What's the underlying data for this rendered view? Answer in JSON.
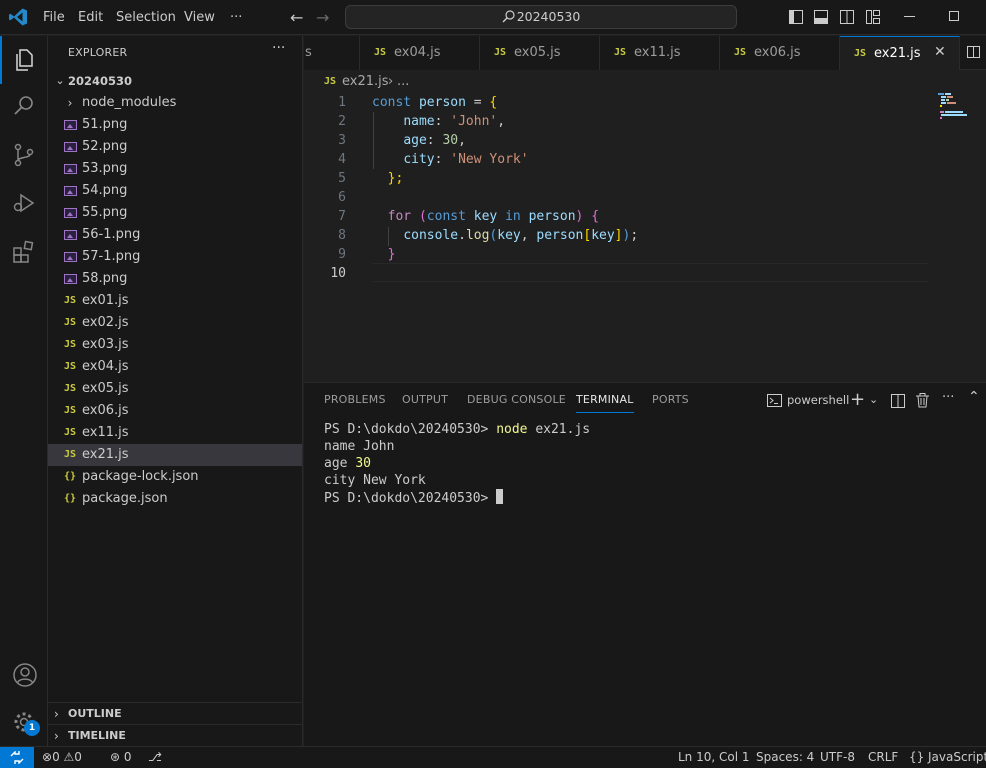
{
  "titlebar": {
    "menus": [
      "File",
      "Edit",
      "Selection",
      "View",
      "···"
    ],
    "search": "20240530"
  },
  "activity": {
    "items": [
      "explorer-icon",
      "search-icon",
      "source-control-icon",
      "run-debug-icon",
      "extensions-icon"
    ],
    "accounts": "account-icon",
    "manage": "gear-icon",
    "manage_badge": "1"
  },
  "explorer": {
    "title": "EXPLORER",
    "more": "···",
    "root": "20240530",
    "items": [
      {
        "label": "node_modules",
        "type": "folder"
      },
      {
        "label": "51.png",
        "type": "png"
      },
      {
        "label": "52.png",
        "type": "png"
      },
      {
        "label": "53.png",
        "type": "png"
      },
      {
        "label": "54.png",
        "type": "png"
      },
      {
        "label": "55.png",
        "type": "png"
      },
      {
        "label": "56-1.png",
        "type": "png"
      },
      {
        "label": "57-1.png",
        "type": "png"
      },
      {
        "label": "58.png",
        "type": "png"
      },
      {
        "label": "ex01.js",
        "type": "js"
      },
      {
        "label": "ex02.js",
        "type": "js"
      },
      {
        "label": "ex03.js",
        "type": "js"
      },
      {
        "label": "ex04.js",
        "type": "js"
      },
      {
        "label": "ex05.js",
        "type": "js"
      },
      {
        "label": "ex06.js",
        "type": "js"
      },
      {
        "label": "ex11.js",
        "type": "js"
      },
      {
        "label": "ex21.js",
        "type": "js",
        "selected": true
      },
      {
        "label": "package-lock.json",
        "type": "json"
      },
      {
        "label": "package.json",
        "type": "json"
      }
    ],
    "outline": "OUTLINE",
    "timeline": "TIMELINE"
  },
  "tabs": {
    "partial": "s",
    "items": [
      "ex04.js",
      "ex05.js",
      "ex11.js",
      "ex06.js",
      "ex21.js"
    ],
    "active": "ex21.js",
    "js_badge": "JS",
    "close": "✕"
  },
  "breadcrumb": {
    "file": "ex21.js",
    "rest": "..."
  },
  "editor": {
    "line_numbers": [
      "1",
      "2",
      "3",
      "4",
      "5",
      "6",
      "7",
      "8",
      "9",
      "10"
    ],
    "current_line": "10",
    "code": {
      "kw_const": "const",
      "var_person": "person",
      "eq": " = ",
      "brace_open": "{",
      "key_name": "name",
      "str_john": "'John'",
      "key_age": "age",
      "num_30": "30",
      "key_city": "city",
      "str_ny": "'New York'",
      "brace_close": "};",
      "kw_for": "for",
      "kw_in": "in",
      "var_key": "key",
      "fn_console": "console",
      "fn_log": "log",
      "close_brace": "}"
    }
  },
  "panel": {
    "tabs": [
      "PROBLEMS",
      "OUTPUT",
      "DEBUG CONSOLE",
      "TERMINAL",
      "PORTS"
    ],
    "active_tab": "TERMINAL",
    "shell": "powershell",
    "terminal": {
      "prompt": "PS D:\\dokdo\\20240530> ",
      "cmd_node": "node",
      "cmd_arg": " ex21.js",
      "out1": "name John",
      "out2_label": "age ",
      "out2_num": "30",
      "out3": "city New York"
    }
  },
  "status": {
    "errors": "0",
    "warnings": "0",
    "ports": "0",
    "position": "Ln 10, Col 1",
    "spaces": "Spaces: 4",
    "encoding": "UTF-8",
    "eol": "CRLF",
    "lang_icon": "{}",
    "language": "JavaScript"
  },
  "colors": {
    "accent": "#0078d4",
    "keyword": "#569cd6",
    "variable": "#9cdcfe",
    "string": "#ce9178",
    "number": "#b5cea8",
    "js_icon": "#cbcb41"
  }
}
